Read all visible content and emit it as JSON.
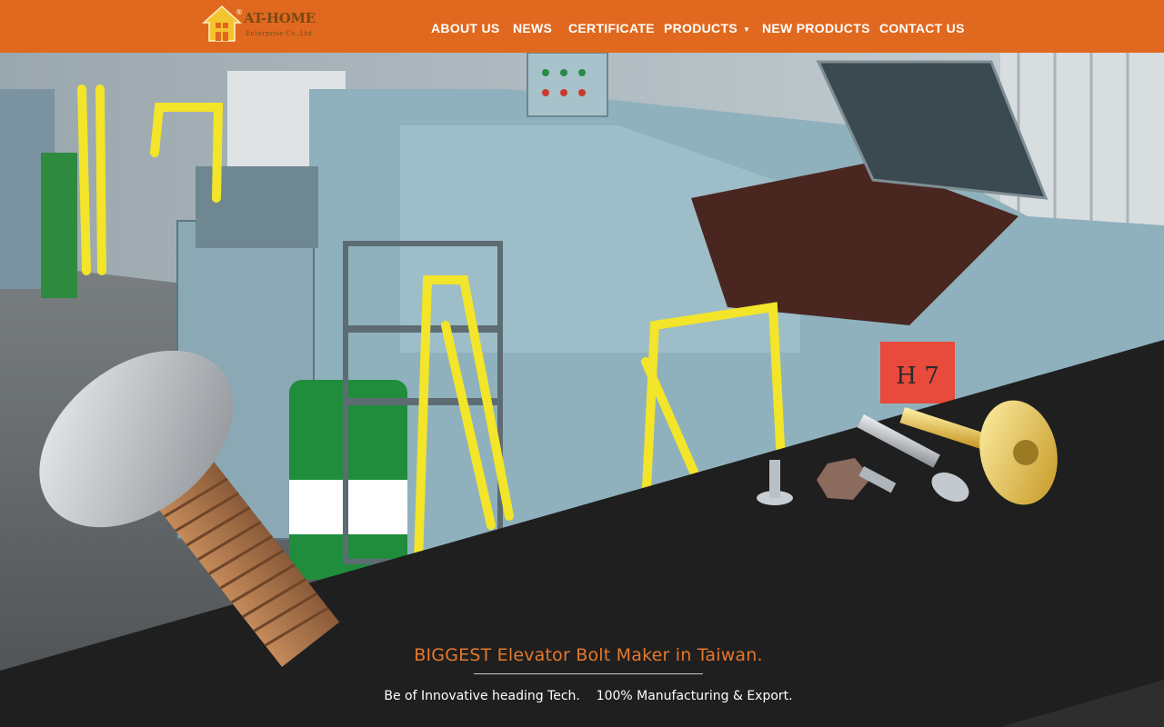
{
  "brand": {
    "name": "AT-HOME",
    "subtitle": "Enterprise Co.,Ltd.",
    "registered": "®"
  },
  "nav": {
    "items": [
      {
        "label": "ABOUT US"
      },
      {
        "label": "NEWS"
      },
      {
        "label": "CERTIFICATE"
      },
      {
        "label": "PRODUCTS",
        "has_dropdown": true
      },
      {
        "label": "NEW PRODUCTS"
      },
      {
        "label": "CONTACT US"
      }
    ]
  },
  "hero": {
    "machine_label": "H 7"
  },
  "tagline": {
    "headline": "BIGGEST Elevator Bolt Maker in Taiwan.",
    "subline": "Be of Innovative heading Tech.    100% Manufacturing & Export."
  },
  "colors": {
    "header_bg": "#e0691f",
    "accent": "#e5782b",
    "dark_panel": "#1f1f1f"
  },
  "icons": {
    "dropdown": "chevron-down-icon",
    "logo": "house-logo-icon"
  }
}
